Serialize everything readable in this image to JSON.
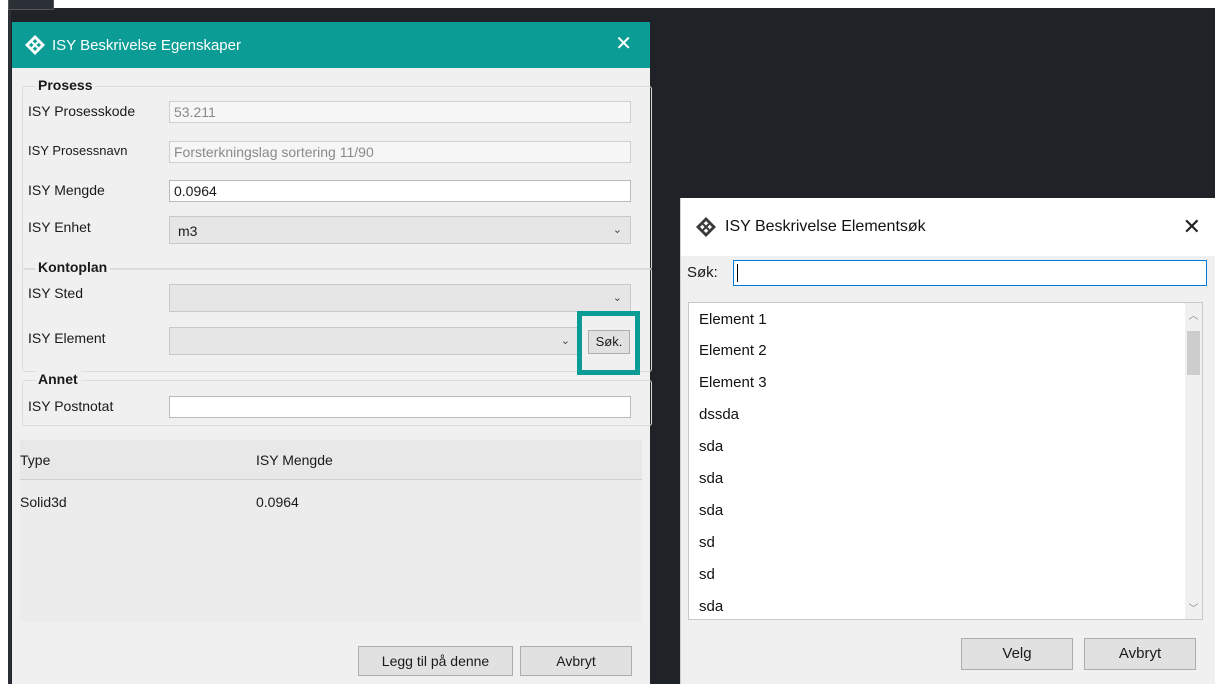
{
  "left_dialog": {
    "title": "ISY Beskrivelse Egenskaper",
    "close_glyph": "✕",
    "groups": {
      "prosess": {
        "title": "Prosess",
        "prosesskode_label": "ISY Prosesskode",
        "prosesskode_value": "53.211",
        "prosessnavn_label": "ISY Prosessnavn",
        "prosessnavn_value": "Forsterkningslag sortering 11/90",
        "mengde_label": "ISY Mengde",
        "mengde_value": "0.0964",
        "enhet_label": "ISY Enhet",
        "enhet_value": "m3"
      },
      "kontoplan": {
        "title": "Kontoplan",
        "sted_label": "ISY Sted",
        "sted_value": "",
        "element_label": "ISY Element",
        "element_value": "",
        "search_button": "Søk."
      },
      "annet": {
        "title": "Annet",
        "postnotat_label": "ISY Postnotat",
        "postnotat_value": ""
      }
    },
    "grid": {
      "columns": [
        "Type",
        "ISY Mengde"
      ],
      "rows": [
        [
          "Solid3d",
          "0.0964"
        ]
      ]
    },
    "buttons": {
      "add": "Legg til på denne",
      "cancel": "Avbryt"
    }
  },
  "right_dialog": {
    "title": "ISY Beskrivelse Elementsøk",
    "close_glyph": "✕",
    "search_label": "Søk:",
    "search_value": "",
    "items": [
      "Element 1",
      "Element 2",
      "Element 3",
      "dssda",
      "sda",
      "sda",
      "sda",
      "sd",
      "sd",
      "sda"
    ],
    "buttons": {
      "select": "Velg",
      "cancel": "Avbryt"
    }
  },
  "colors": {
    "accent": "#0b9c95",
    "background_dark": "#1f2328",
    "dialog_bg": "#f0f0f0",
    "focus_border": "#0078d7"
  },
  "icons": {
    "app": "isy-app-icon",
    "close": "close-icon",
    "dropdown": "chevron-down-icon",
    "scroll_up": "chevron-up-icon",
    "scroll_down": "chevron-down-icon"
  }
}
